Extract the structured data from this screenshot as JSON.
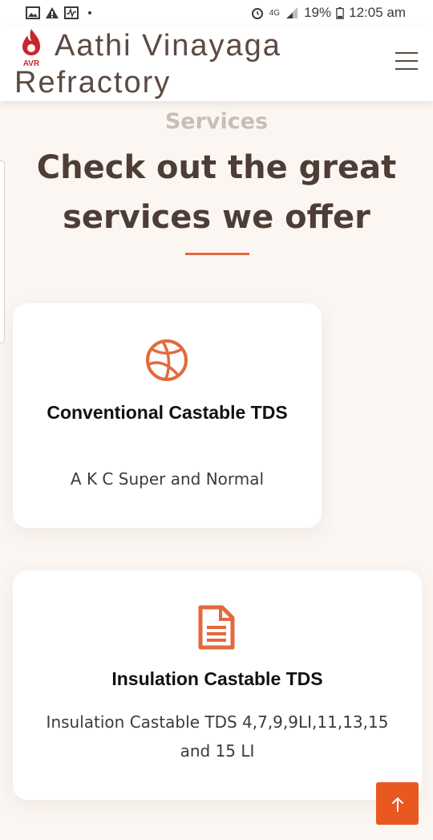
{
  "status_bar": {
    "network": "4G",
    "battery": "19%",
    "time": "12:05 am",
    "icons": [
      "image-icon",
      "warning-icon",
      "activity-icon",
      "dot-icon",
      "alarm-icon",
      "signal-icon",
      "battery-icon"
    ]
  },
  "header": {
    "logo_text": "AVR",
    "brand_line1": "Aathi Vinayaga",
    "brand_line2": "Refractory",
    "menu_icon": "hamburger-menu-icon"
  },
  "services": {
    "section_label": "Services",
    "headline": "Check out the great services we offer",
    "accent_color": "#e26a3c",
    "cards": [
      {
        "icon": "basketball-icon",
        "title": "Conventional Castable TDS",
        "description": "A K C Super and Normal"
      },
      {
        "icon": "document-icon",
        "title": "Insulation Castable TDS",
        "description": "Insulation Castable TDS 4,7,9,9LI,11,13,15 and 15 LI"
      }
    ]
  },
  "scroll_top": {
    "icon": "arrow-up-icon",
    "color": "#e8581f"
  }
}
